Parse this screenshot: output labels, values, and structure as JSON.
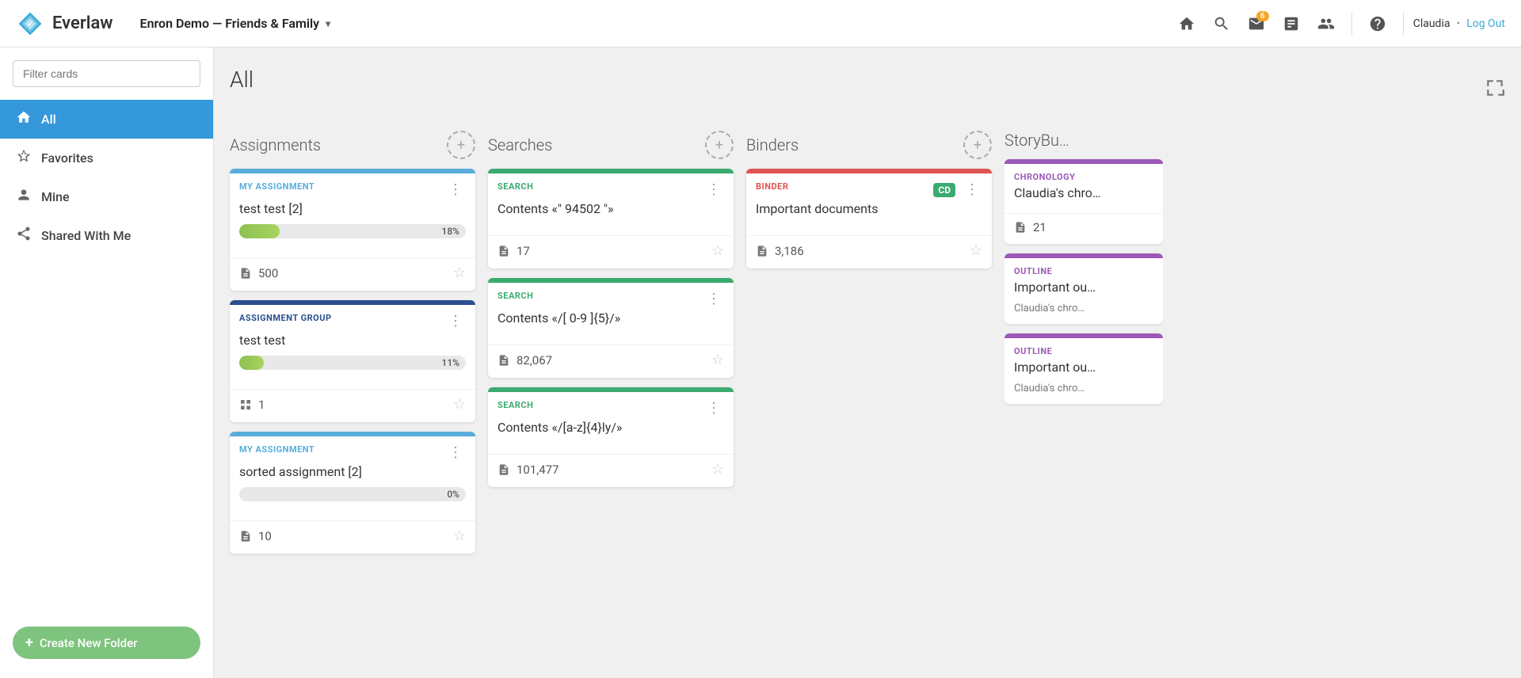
{
  "header": {
    "logo_text": "Everlaw",
    "project_name": "Enron Demo — Friends & Family",
    "notification_badge": "6",
    "user_name": "Claudia",
    "logout_label": "Log Out"
  },
  "sidebar": {
    "filter_placeholder": "Filter cards",
    "nav_items": [
      {
        "id": "all",
        "label": "All",
        "icon": "🏠",
        "active": true
      },
      {
        "id": "favorites",
        "label": "Favorites",
        "icon": "☆",
        "active": false
      },
      {
        "id": "mine",
        "label": "Mine",
        "icon": "👤",
        "active": false
      },
      {
        "id": "shared",
        "label": "Shared With Me",
        "icon": "🔗",
        "active": false
      }
    ],
    "create_folder_label": "Create New Folder"
  },
  "main": {
    "page_title": "All",
    "columns": [
      {
        "id": "assignments",
        "title": "Assignments",
        "cards": [
          {
            "type": "MY ASSIGNMENT",
            "type_class": "card-type-my-assignment",
            "bar_color": "#5aaddb",
            "title": "test test [2]",
            "progress": 18,
            "progress_label": "18%",
            "doc_count": "500",
            "has_grid_icon": false
          },
          {
            "type": "ASSIGNMENT GROUP",
            "type_class": "card-type-assignment-group",
            "bar_color": "#2c4f8f",
            "title": "test test",
            "progress": 11,
            "progress_label": "11%",
            "doc_count": "1",
            "has_grid_icon": true
          },
          {
            "type": "MY ASSIGNMENT",
            "type_class": "card-type-my-assignment",
            "bar_color": "#5aaddb",
            "title": "sorted assignment [2]",
            "progress": 0,
            "progress_label": "0%",
            "doc_count": "10",
            "has_grid_icon": false
          }
        ]
      },
      {
        "id": "searches",
        "title": "Searches",
        "cards": [
          {
            "type": "SEARCH",
            "type_class": "card-type-search",
            "bar_color": "#3aaa6e",
            "title": "Contents «\" 94502 \"»",
            "doc_count": "17",
            "has_grid_icon": false
          },
          {
            "type": "SEARCH",
            "type_class": "card-type-search",
            "bar_color": "#3aaa6e",
            "title": "Contents «/[ 0-9 ]{5}/»",
            "doc_count": "82,067",
            "has_grid_icon": false
          },
          {
            "type": "SEARCH",
            "type_class": "card-type-search",
            "bar_color": "#3aaa6e",
            "title": "Contents «/[a-z]{4}ly/»",
            "doc_count": "101,477",
            "has_grid_icon": false
          }
        ]
      },
      {
        "id": "binders",
        "title": "Binders",
        "cards": [
          {
            "type": "BINDER",
            "type_class": "card-type-binder",
            "bar_color": "#e05252",
            "title": "Important documents",
            "doc_count": "3,186",
            "binder_badge": "CD",
            "has_grid_icon": false
          }
        ]
      },
      {
        "id": "storybuilder",
        "title": "StoryBu…",
        "cards": [
          {
            "type": "CHRONOLOGY",
            "type_class": "card-type-chronology",
            "bar_color": "#9b59b6",
            "title": "Claudia's chro…",
            "doc_count": "21",
            "has_grid_icon": false
          },
          {
            "type": "OUTLINE",
            "type_class": "card-type-outline",
            "bar_color": "#9b59b6",
            "title": "Important ou…",
            "subtitle": "Claudia's chro…",
            "doc_count": "",
            "has_grid_icon": false
          },
          {
            "type": "OUTLINE",
            "type_class": "card-type-outline",
            "bar_color": "#9b59b6",
            "title": "Important ou…",
            "subtitle": "Claudia's chro…",
            "doc_count": "",
            "has_grid_icon": false
          }
        ]
      }
    ]
  }
}
